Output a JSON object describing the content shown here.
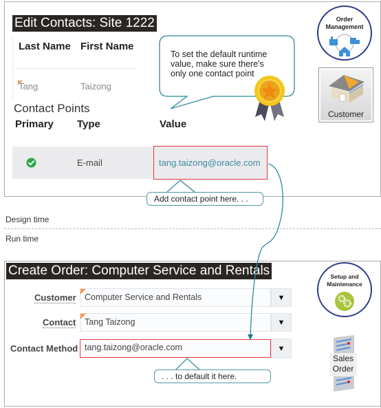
{
  "design_panel": {
    "title": "Edit Contacts: Site 1222",
    "contacts_table": {
      "headers": [
        "Last Name",
        "First Name"
      ],
      "rows": [
        {
          "last_name": "Tang",
          "first_name": "Taizong"
        }
      ]
    },
    "contact_points_title": "Contact Points",
    "contact_points_table": {
      "headers": [
        "Primary",
        "Type",
        "Value"
      ],
      "rows": [
        {
          "primary": "check-circle-icon",
          "type": "E-mail",
          "value": "tang.taizong@oracle.com"
        }
      ]
    },
    "speech_callout": "To set the default runtime value, make sure there's only one contact point",
    "add_callout": "Add contact point here. . .",
    "badge": {
      "line1": "Order",
      "line2": "Management"
    },
    "customer_tile": "Customer"
  },
  "divider": {
    "design_time": "Design time",
    "run_time": "Run time"
  },
  "runtime_panel": {
    "title": "Create Order: Computer Service and Rentals",
    "fields": [
      {
        "label": "Customer",
        "value": "Computer Service and Rentals"
      },
      {
        "label": "Contact",
        "value": "Tang Taizong"
      },
      {
        "label": "Contact Method",
        "value": "tang.taizong@oracle.com"
      }
    ],
    "default_callout": ". . . to default it here.",
    "badge": {
      "line1": "Setup and",
      "line2": "Maintenance"
    },
    "sales_order_tile": {
      "line1": "Sales",
      "line2": "Order"
    }
  },
  "colors": {
    "highlight_red": "#e0363c",
    "callout_teal": "#4e98aa",
    "link_teal": "#3d8aa0",
    "required_orange": "#f39b5b",
    "primary_green": "#2aa84a"
  }
}
